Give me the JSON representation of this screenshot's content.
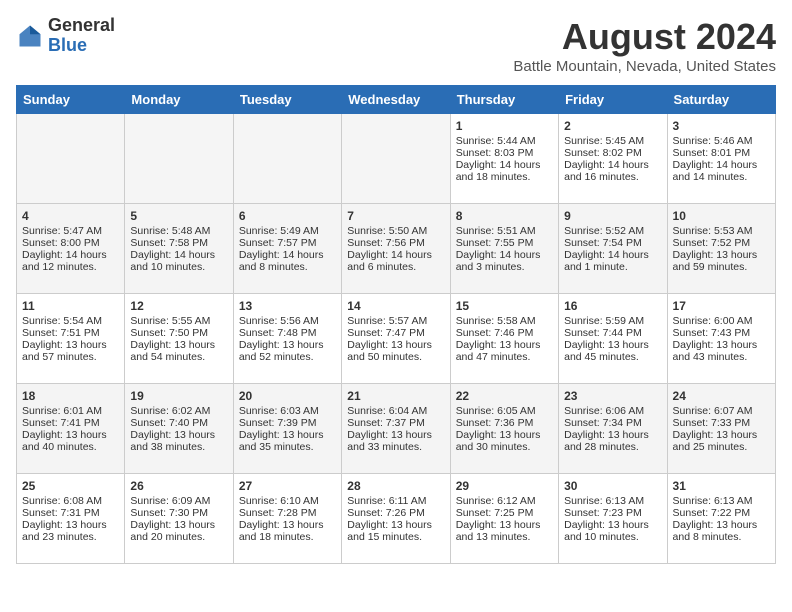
{
  "logo": {
    "general": "General",
    "blue": "Blue"
  },
  "title": "August 2024",
  "subtitle": "Battle Mountain, Nevada, United States",
  "days": [
    "Sunday",
    "Monday",
    "Tuesday",
    "Wednesday",
    "Thursday",
    "Friday",
    "Saturday"
  ],
  "weeks": [
    [
      {
        "day": "",
        "info": ""
      },
      {
        "day": "",
        "info": ""
      },
      {
        "day": "",
        "info": ""
      },
      {
        "day": "",
        "info": ""
      },
      {
        "day": "1",
        "info": "Sunrise: 5:44 AM\nSunset: 8:03 PM\nDaylight: 14 hours\nand 18 minutes."
      },
      {
        "day": "2",
        "info": "Sunrise: 5:45 AM\nSunset: 8:02 PM\nDaylight: 14 hours\nand 16 minutes."
      },
      {
        "day": "3",
        "info": "Sunrise: 5:46 AM\nSunset: 8:01 PM\nDaylight: 14 hours\nand 14 minutes."
      }
    ],
    [
      {
        "day": "4",
        "info": "Sunrise: 5:47 AM\nSunset: 8:00 PM\nDaylight: 14 hours\nand 12 minutes."
      },
      {
        "day": "5",
        "info": "Sunrise: 5:48 AM\nSunset: 7:58 PM\nDaylight: 14 hours\nand 10 minutes."
      },
      {
        "day": "6",
        "info": "Sunrise: 5:49 AM\nSunset: 7:57 PM\nDaylight: 14 hours\nand 8 minutes."
      },
      {
        "day": "7",
        "info": "Sunrise: 5:50 AM\nSunset: 7:56 PM\nDaylight: 14 hours\nand 6 minutes."
      },
      {
        "day": "8",
        "info": "Sunrise: 5:51 AM\nSunset: 7:55 PM\nDaylight: 14 hours\nand 3 minutes."
      },
      {
        "day": "9",
        "info": "Sunrise: 5:52 AM\nSunset: 7:54 PM\nDaylight: 14 hours\nand 1 minute."
      },
      {
        "day": "10",
        "info": "Sunrise: 5:53 AM\nSunset: 7:52 PM\nDaylight: 13 hours\nand 59 minutes."
      }
    ],
    [
      {
        "day": "11",
        "info": "Sunrise: 5:54 AM\nSunset: 7:51 PM\nDaylight: 13 hours\nand 57 minutes."
      },
      {
        "day": "12",
        "info": "Sunrise: 5:55 AM\nSunset: 7:50 PM\nDaylight: 13 hours\nand 54 minutes."
      },
      {
        "day": "13",
        "info": "Sunrise: 5:56 AM\nSunset: 7:48 PM\nDaylight: 13 hours\nand 52 minutes."
      },
      {
        "day": "14",
        "info": "Sunrise: 5:57 AM\nSunset: 7:47 PM\nDaylight: 13 hours\nand 50 minutes."
      },
      {
        "day": "15",
        "info": "Sunrise: 5:58 AM\nSunset: 7:46 PM\nDaylight: 13 hours\nand 47 minutes."
      },
      {
        "day": "16",
        "info": "Sunrise: 5:59 AM\nSunset: 7:44 PM\nDaylight: 13 hours\nand 45 minutes."
      },
      {
        "day": "17",
        "info": "Sunrise: 6:00 AM\nSunset: 7:43 PM\nDaylight: 13 hours\nand 43 minutes."
      }
    ],
    [
      {
        "day": "18",
        "info": "Sunrise: 6:01 AM\nSunset: 7:41 PM\nDaylight: 13 hours\nand 40 minutes."
      },
      {
        "day": "19",
        "info": "Sunrise: 6:02 AM\nSunset: 7:40 PM\nDaylight: 13 hours\nand 38 minutes."
      },
      {
        "day": "20",
        "info": "Sunrise: 6:03 AM\nSunset: 7:39 PM\nDaylight: 13 hours\nand 35 minutes."
      },
      {
        "day": "21",
        "info": "Sunrise: 6:04 AM\nSunset: 7:37 PM\nDaylight: 13 hours\nand 33 minutes."
      },
      {
        "day": "22",
        "info": "Sunrise: 6:05 AM\nSunset: 7:36 PM\nDaylight: 13 hours\nand 30 minutes."
      },
      {
        "day": "23",
        "info": "Sunrise: 6:06 AM\nSunset: 7:34 PM\nDaylight: 13 hours\nand 28 minutes."
      },
      {
        "day": "24",
        "info": "Sunrise: 6:07 AM\nSunset: 7:33 PM\nDaylight: 13 hours\nand 25 minutes."
      }
    ],
    [
      {
        "day": "25",
        "info": "Sunrise: 6:08 AM\nSunset: 7:31 PM\nDaylight: 13 hours\nand 23 minutes."
      },
      {
        "day": "26",
        "info": "Sunrise: 6:09 AM\nSunset: 7:30 PM\nDaylight: 13 hours\nand 20 minutes."
      },
      {
        "day": "27",
        "info": "Sunrise: 6:10 AM\nSunset: 7:28 PM\nDaylight: 13 hours\nand 18 minutes."
      },
      {
        "day": "28",
        "info": "Sunrise: 6:11 AM\nSunset: 7:26 PM\nDaylight: 13 hours\nand 15 minutes."
      },
      {
        "day": "29",
        "info": "Sunrise: 6:12 AM\nSunset: 7:25 PM\nDaylight: 13 hours\nand 13 minutes."
      },
      {
        "day": "30",
        "info": "Sunrise: 6:13 AM\nSunset: 7:23 PM\nDaylight: 13 hours\nand 10 minutes."
      },
      {
        "day": "31",
        "info": "Sunrise: 6:13 AM\nSunset: 7:22 PM\nDaylight: 13 hours\nand 8 minutes."
      }
    ]
  ]
}
